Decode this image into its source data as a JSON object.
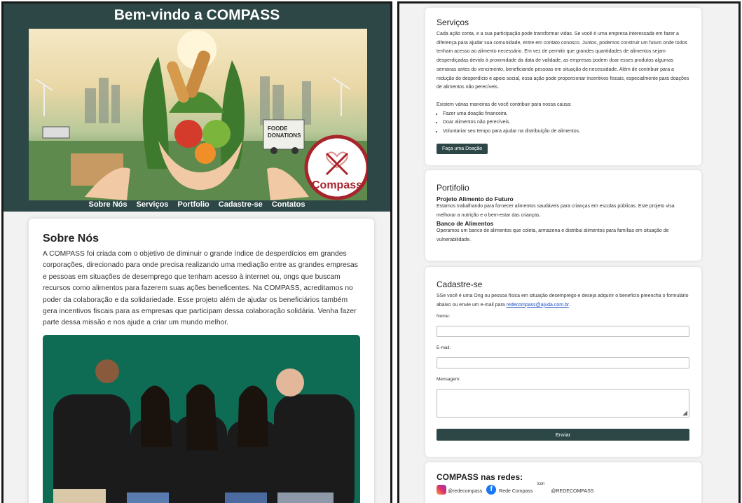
{
  "left": {
    "title": "Bem-vindo a COMPASS",
    "nav": [
      "Sobre Nós",
      "Serviços",
      "Portfolio",
      "Cadastre-se",
      "Contatos"
    ],
    "hero": {
      "sign_line1": "FOODE",
      "sign_line2": "DONATIONS",
      "badge": "Compass"
    },
    "about": {
      "heading": "Sobre Nós",
      "text": "A COMPASS foi criada com o objetivo de diminuir o grande índice de desperdícios em grandes corporações, direcionado para onde precisa realizando uma mediação entre as grandes empresas e pessoas em situações de desemprego que tenham acesso à internet ou, ongs que buscam recursos como alimentos para fazerem suas ações beneficentes. Na COMPASS, acreditamos no poder da colaboração e da solidariedade. Esse projeto além de ajudar os beneficiários também gera incentivos fiscais para as empresas que participam dessa colaboração solidária. Venha fazer parte dessa missão e nos ajude a criar um mundo melhor."
    },
    "colors": {
      "header": "#2d4747",
      "team_bg": "#0e6b54"
    }
  },
  "right": {
    "services": {
      "heading": "Serviços",
      "text": "Cada ação conta, e a sua participação pode transformar vidas. Se você é uma empresa interessada em fazer a diferença para ajudar sua comunidade, entre em contato conosco. Juntos, podemos construir um futuro onde todos tenham acesso ao alimento necessário. Em vez de permitir que grandes quantidades de alimentos sejam desperdiçadas devido à proximidade da data de validade, as empresas podem doar esses produtos algumas semanas antes do vencimento, beneficiando pessoas em situação de necessidade. Além de contribuir para a redução do desperdício e apoio social, essa ação pode proporcionar incentivos fiscais, especialmente para doações de alimentos não perecíveis.",
      "intro": "Existem várias maneiras de você contribuir para nossa causa:",
      "items": [
        "Fazer uma doação financeira.",
        "Doar alimentos não perecíveis.",
        "Voluntariar seu tempo para ajudar na distribuição de alimentos."
      ],
      "button": "Faça uma Doação"
    },
    "portfolio": {
      "heading": "Portifolio",
      "p1_title": "Projeto Alimento do Futuro",
      "p1_text": "Estamos trabalhando para fornecer alimentos saudáveis para crianças em escolas públicas. Este projeto visa melhorar a nutrição e o bem-estar das crianças.",
      "p2_title": "Banco de Alimentos",
      "p2_text": "Operamos um banco de alimentos que coleta, armazena e distribui alimentos para famílias em situação de vulnerabilidade."
    },
    "register": {
      "heading": "Cadastre-se",
      "text_before": "SSe você é uma Ong ou pessoa física em situação desemprego e deseja adquirir o benefício preencha o formulário abaixo ou envie um e-mail para ",
      "email": "redecompass@ajuda.com.br",
      "text_after": ".",
      "name_label": "Nome:",
      "email_label": "E-mail:",
      "message_label": "Mensagem:",
      "submit": "Enviar"
    },
    "social": {
      "heading": "COMPASS nas redes:",
      "instagram": "@redecompass",
      "facebook": "Rede Compass",
      "third_alt": "icon",
      "third": "@REDECOMPASS"
    }
  }
}
